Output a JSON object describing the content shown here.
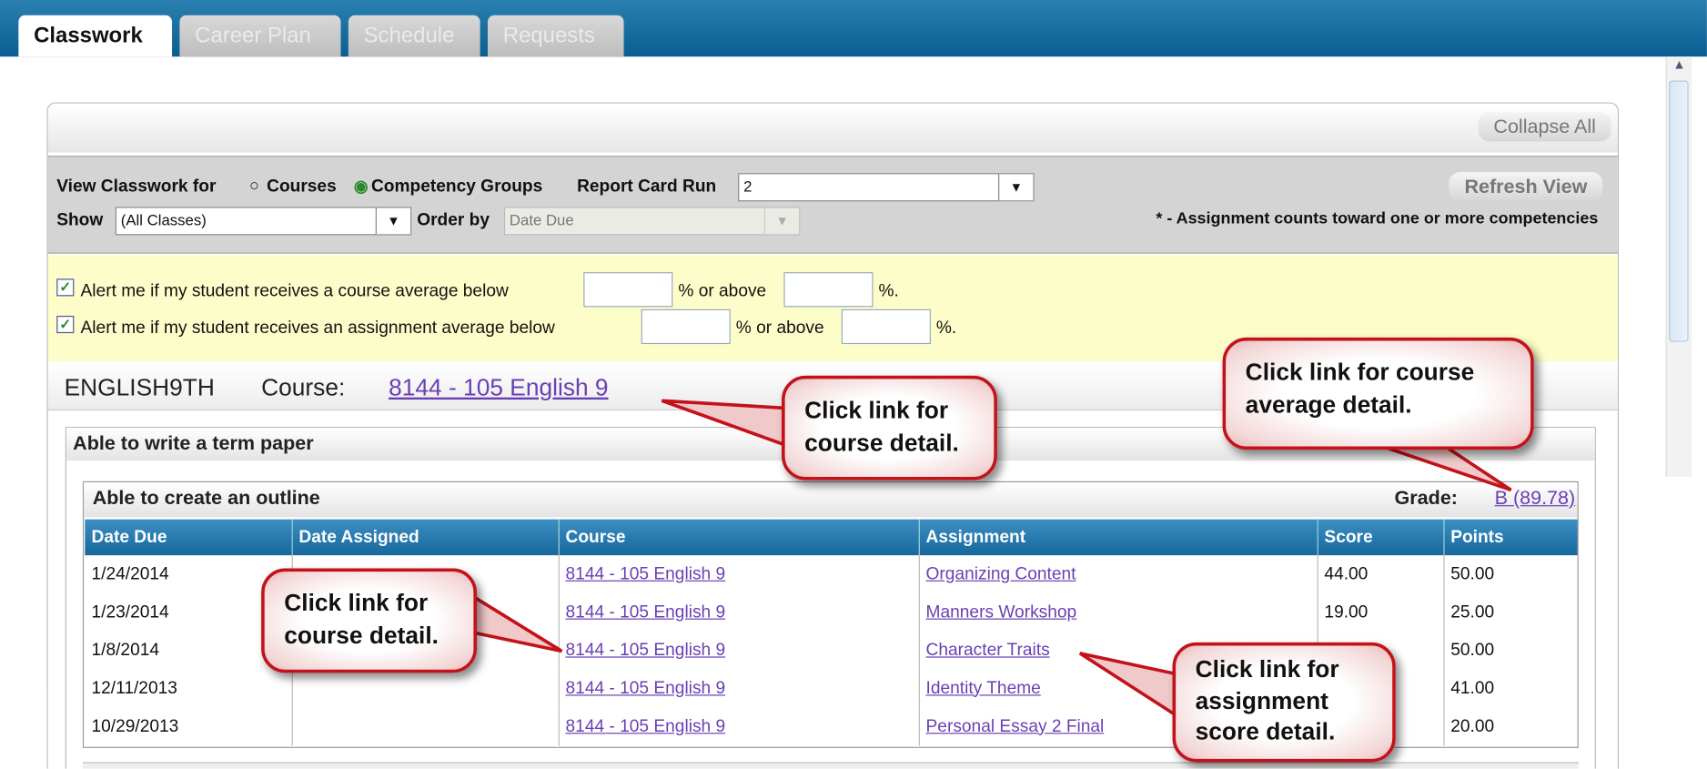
{
  "tabs": [
    "Classwork",
    "Career Plan",
    "Schedule",
    "Requests"
  ],
  "header": {
    "collapse_all": "Collapse All",
    "refresh_view": "Refresh View"
  },
  "filters": {
    "view_label": "View Classwork for",
    "opt_courses": "Courses",
    "opt_groups": "Competency Groups",
    "report_card_run_label": "Report Card Run",
    "report_card_run_value": "2",
    "show_label": "Show",
    "show_value": "(All Classes)",
    "order_by_label": "Order by",
    "order_by_value": "Date Due",
    "note": "* - Assignment counts toward one or more competencies"
  },
  "alerts": [
    {
      "text": "Alert me if my student receives a course average below",
      "mid": "% or above",
      "end": "%.",
      "checked": true
    },
    {
      "text": "Alert me if my student receives an assignment average below",
      "mid": "% or above",
      "end": "%.",
      "checked": true
    }
  ],
  "course": {
    "code": "ENGLISH9TH",
    "label": "Course:",
    "link": "8144 - 105 English 9"
  },
  "competency": "Able to write a term paper",
  "subcompetency": {
    "title": "Able to create an outline",
    "grade_label": "Grade:",
    "grade": "B (89.78)"
  },
  "table": {
    "headers": [
      "Date Due",
      "Date Assigned",
      "Course",
      "Assignment",
      "Score",
      "Points"
    ],
    "rows": [
      {
        "due": "1/24/2014",
        "assigned": "",
        "course": "8144 - 105 English 9",
        "assignment": "Organizing Content",
        "score": "44.00",
        "points": "50.00"
      },
      {
        "due": "1/23/2014",
        "assigned": "",
        "course": "8144 - 105 English 9",
        "assignment": "Manners Workshop",
        "score": "19.00",
        "points": "25.00"
      },
      {
        "due": "1/8/2014",
        "assigned": "",
        "course": "8144 - 105 English 9",
        "assignment": "Character Traits",
        "score": "",
        "points": "50.00"
      },
      {
        "due": "12/11/2013",
        "assigned": "",
        "course": "8144 - 105 English 9",
        "assignment": "Identity Theme",
        "score": "",
        "points": "41.00"
      },
      {
        "due": "10/29/2013",
        "assigned": "",
        "course": "8144 - 105 English 9",
        "assignment": "Personal Essay 2 Final",
        "score": "",
        "points": "20.00"
      }
    ]
  },
  "callouts": {
    "course_detail_top": "Click link for course detail.",
    "course_average": "Click link for course average detail.",
    "course_detail_row": "Click link for course detail.",
    "assignment_score": "Click link for assignment score detail."
  },
  "colors": {
    "tab_bar": "#0a5e92",
    "link": "#6a3fb5",
    "callout_border": "#c3121a",
    "alert_bg": "#fdfdca"
  }
}
